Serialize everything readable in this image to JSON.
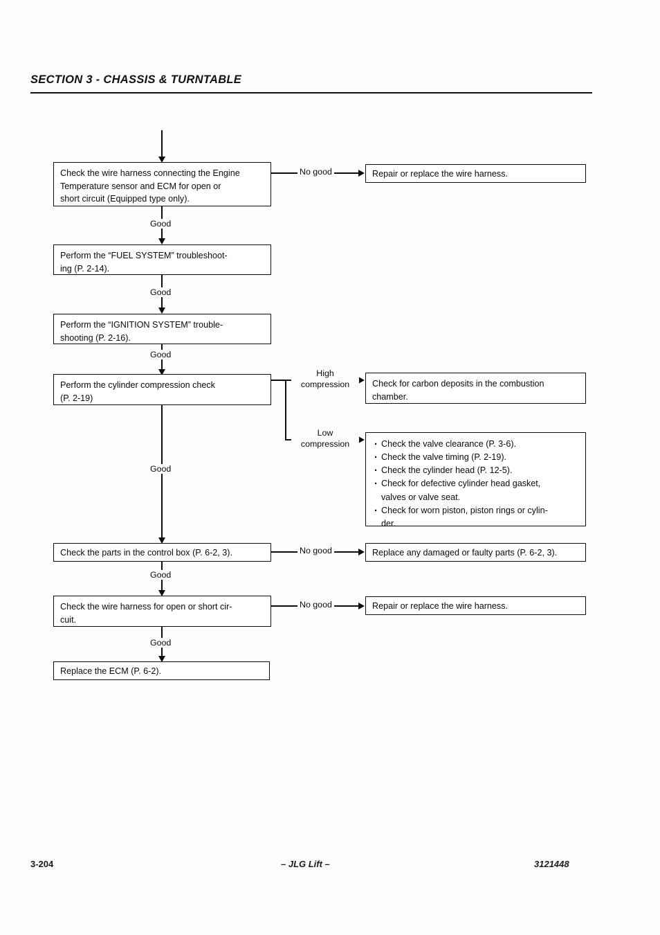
{
  "header": {
    "section_title": "SECTION 3 - CHASSIS & TURNTABLE"
  },
  "footer": {
    "page_number": "3-204",
    "center_text": "– JLG Lift –",
    "document_number": "3121448"
  },
  "flowchart": {
    "nodes": {
      "check_engine_temp_harness": {
        "line1": "Check the wire harness connecting the Engine",
        "line2": "Temperature sensor and ECM for open or",
        "line3": "short circuit (Equipped type only)."
      },
      "repair_harness_1": {
        "line1": "Repair or replace the wire harness."
      },
      "fuel_system": {
        "line1": "Perform the “FUEL SYSTEM” troubleshoot-",
        "line2": "ing (P. 2-14)."
      },
      "ignition_system": {
        "line1": "Perform the “IGNITION SYSTEM” trouble-",
        "line2": "shooting (P. 2-16)."
      },
      "compression_check": {
        "line1": "Perform the cylinder compression check",
        "line2": "(P. 2-19)"
      },
      "carbon_deposits": {
        "line1": "Check for carbon deposits in the combustion",
        "line2": "chamber."
      },
      "low_compression_list": {
        "items": [
          "Check the valve clearance (P. 3-6).",
          "Check the valve timing (P. 2-19).",
          "Check the cylinder head (P. 12-5).",
          "Check for defective cylinder head gasket,",
          "Check for worn piston, piston rings or cylin-"
        ],
        "continuation_4": "valves or valve seat.",
        "continuation_5": "der."
      },
      "control_box_parts": {
        "line1": "Check the parts in the control box (P. 6-2, 3)."
      },
      "replace_faulty_parts": {
        "line1": "Replace any damaged or faulty parts (P. 6-2, 3)."
      },
      "check_harness_short": {
        "line1": "Check the wire harness for open or short cir-",
        "line2": "cuit."
      },
      "repair_harness_2": {
        "line1": "Repair or replace the wire harness."
      },
      "replace_ecm": {
        "line1": "Replace the ECM (P. 6-2)."
      }
    },
    "edge_labels": {
      "no_good_1": "No good",
      "good_1": "Good",
      "good_2": "Good",
      "good_3": "Good",
      "high_compression_l1": "High",
      "high_compression_l2": "compression",
      "low_compression_l1": "Low",
      "low_compression_l2": "compression",
      "good_4": "Good",
      "no_good_2": "No good",
      "good_5": "Good",
      "no_good_3": "No good",
      "good_6": "Good"
    }
  },
  "colors": {
    "ink": "#0c0c0c",
    "paper": "#fdfdfd"
  }
}
